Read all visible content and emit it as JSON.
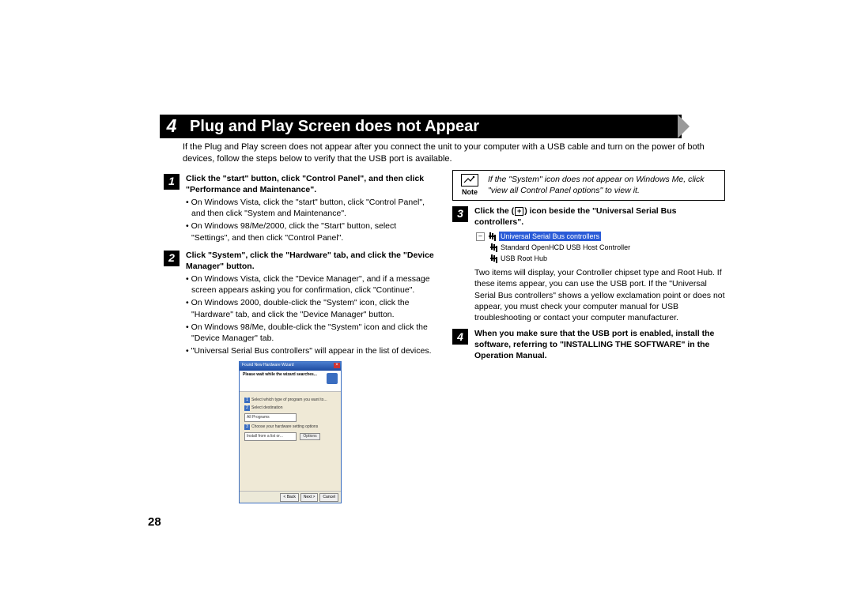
{
  "header": {
    "section_number": "4",
    "title": "Plug and Play Screen does not Appear"
  },
  "intro": "If the Plug and Play screen does not appear after you connect the unit to your computer with a USB cable and turn on the power of both devices, follow the steps below to verify that the USB port is available.",
  "page_number": "28",
  "steps": {
    "s1": {
      "num": "1",
      "bold": "Click the \"start\" button, click \"Control Panel\", and then click \"Performance and Maintenance\".",
      "b1": "On Windows Vista, click the \"start\" button, click \"Control Panel\", and then click \"System and Maintenance\".",
      "b2": "On Windows 98/Me/2000, click the \"Start\" button, select \"Settings\", and then click \"Control Panel\"."
    },
    "s2": {
      "num": "2",
      "bold": "Click \"System\", click the \"Hardware\" tab, and click the \"Device Manager\" button.",
      "b1": "On Windows Vista, click the \"Device Manager\", and if a message screen appears asking you for confirmation, click \"Continue\".",
      "b2": "On Windows 2000, double-click the \"System\" icon, click the \"Hardware\" tab, and click the \"Device Manager\" button.",
      "b3": "On Windows 98/Me, double-click the \"System\" icon and click the \"Device Manager\" tab.",
      "b4": "\"Universal Serial Bus controllers\" will appear in the list of devices."
    },
    "s3": {
      "num": "3",
      "bold_pre": "Click the (",
      "bold_post": ") icon beside the \"Universal Serial Bus controllers\".",
      "plus": "+",
      "tree_root": "Universal Serial Bus controllers",
      "tree_item1": "Standard OpenHCD USB Host Controller",
      "tree_item2": "USB Root Hub",
      "post": "Two items will display, your Controller chipset type and Root Hub. If these items appear, you can use the USB port. If the \"Universal Serial Bus controllers\" shows a yellow exclamation point or does not appear, you must check your computer manual for USB troubleshooting or contact your computer manufacturer."
    },
    "s4": {
      "num": "4",
      "bold": "When you make sure that the USB port is enabled, install the software, referring to \"INSTALLING THE SOFTWARE\" in the Operation Manual."
    }
  },
  "note": {
    "label": "Note",
    "text": "If the \"System\" icon does not appear on Windows Me, click \"view all Control Panel options\" to view it."
  },
  "wizard": {
    "title": "Found New Hardware Wizard",
    "head1": "Please wait while the wizard searches...",
    "head2": "",
    "row1": "Select which type of program you want to...",
    "combo": "All Programs",
    "row2": "Select destination",
    "row3": "Choose your hardware setting options",
    "opt": "Install from a list or...",
    "btn_options": "Options",
    "btn_back": "< Back",
    "btn_next": "Next >",
    "btn_cancel": "Cancel"
  }
}
